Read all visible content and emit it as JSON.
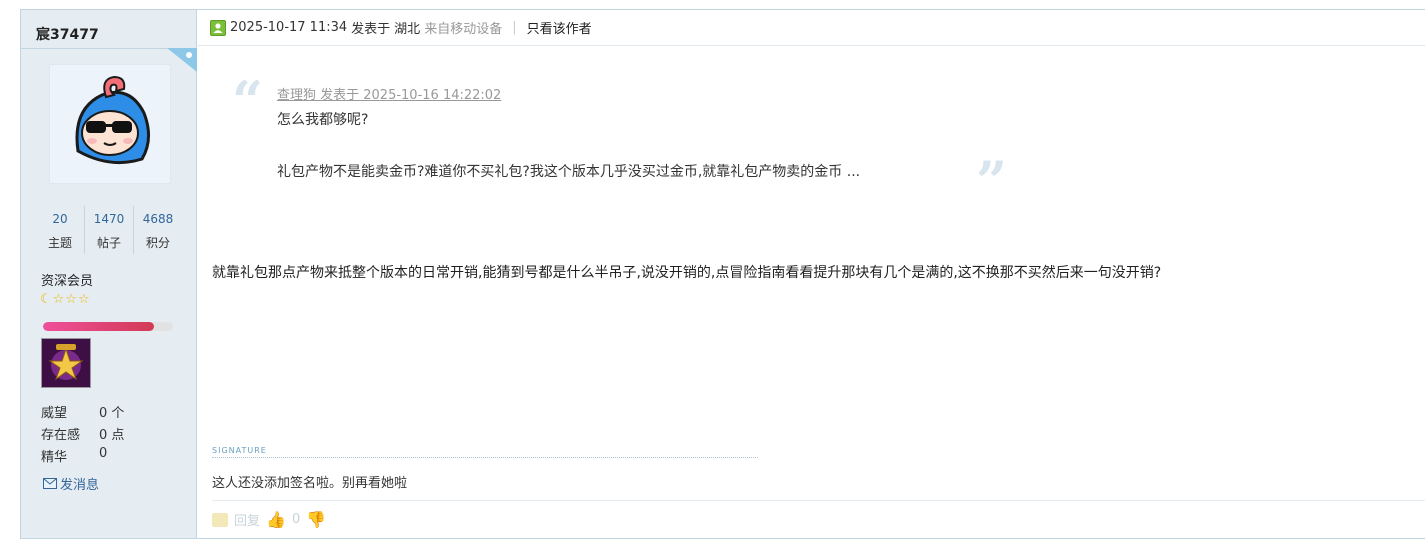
{
  "user": {
    "name": "宸37477",
    "stats": [
      {
        "value": "20",
        "label": "主题"
      },
      {
        "value": "1470",
        "label": "帖子"
      },
      {
        "value": "4688",
        "label": "积分"
      }
    ],
    "level": "资深会员",
    "level_progress": 0.85,
    "info": [
      {
        "key": "威望",
        "value": "0 个"
      },
      {
        "key": "存在感",
        "value": "0 点"
      },
      {
        "key": "精华",
        "value": "0"
      }
    ],
    "send_message": "发消息"
  },
  "post": {
    "date": "2025-10-17 11:34",
    "posted_at_label": "发表于",
    "location": "湖北",
    "device": "来自移动设备",
    "only_author": "只看该作者",
    "quote": {
      "meta": "查理狗 发表于 2025-10-16 14:22:02",
      "line1": "怎么我都够呢?",
      "line2": "礼包产物不是能卖金币?难道你不买礼包?我这个版本几乎没买过金币,就靠礼包产物卖的金币 ..."
    },
    "body": "就靠礼包那点产物来抵整个版本的日常开销,能猜到号都是什么半吊子,说没开销的,点冒险指南看看提升那块有几个是满的,这不换那不买然后来一句没开销?",
    "signature_label": "SIGNATURE",
    "signature": "这人还没添加签名啦。别再看她啦",
    "reply_label": "回复",
    "like_count": "0"
  },
  "colors": {
    "side_bg": "#e5edf2",
    "link": "#336699",
    "border": "#c2d5e3"
  }
}
